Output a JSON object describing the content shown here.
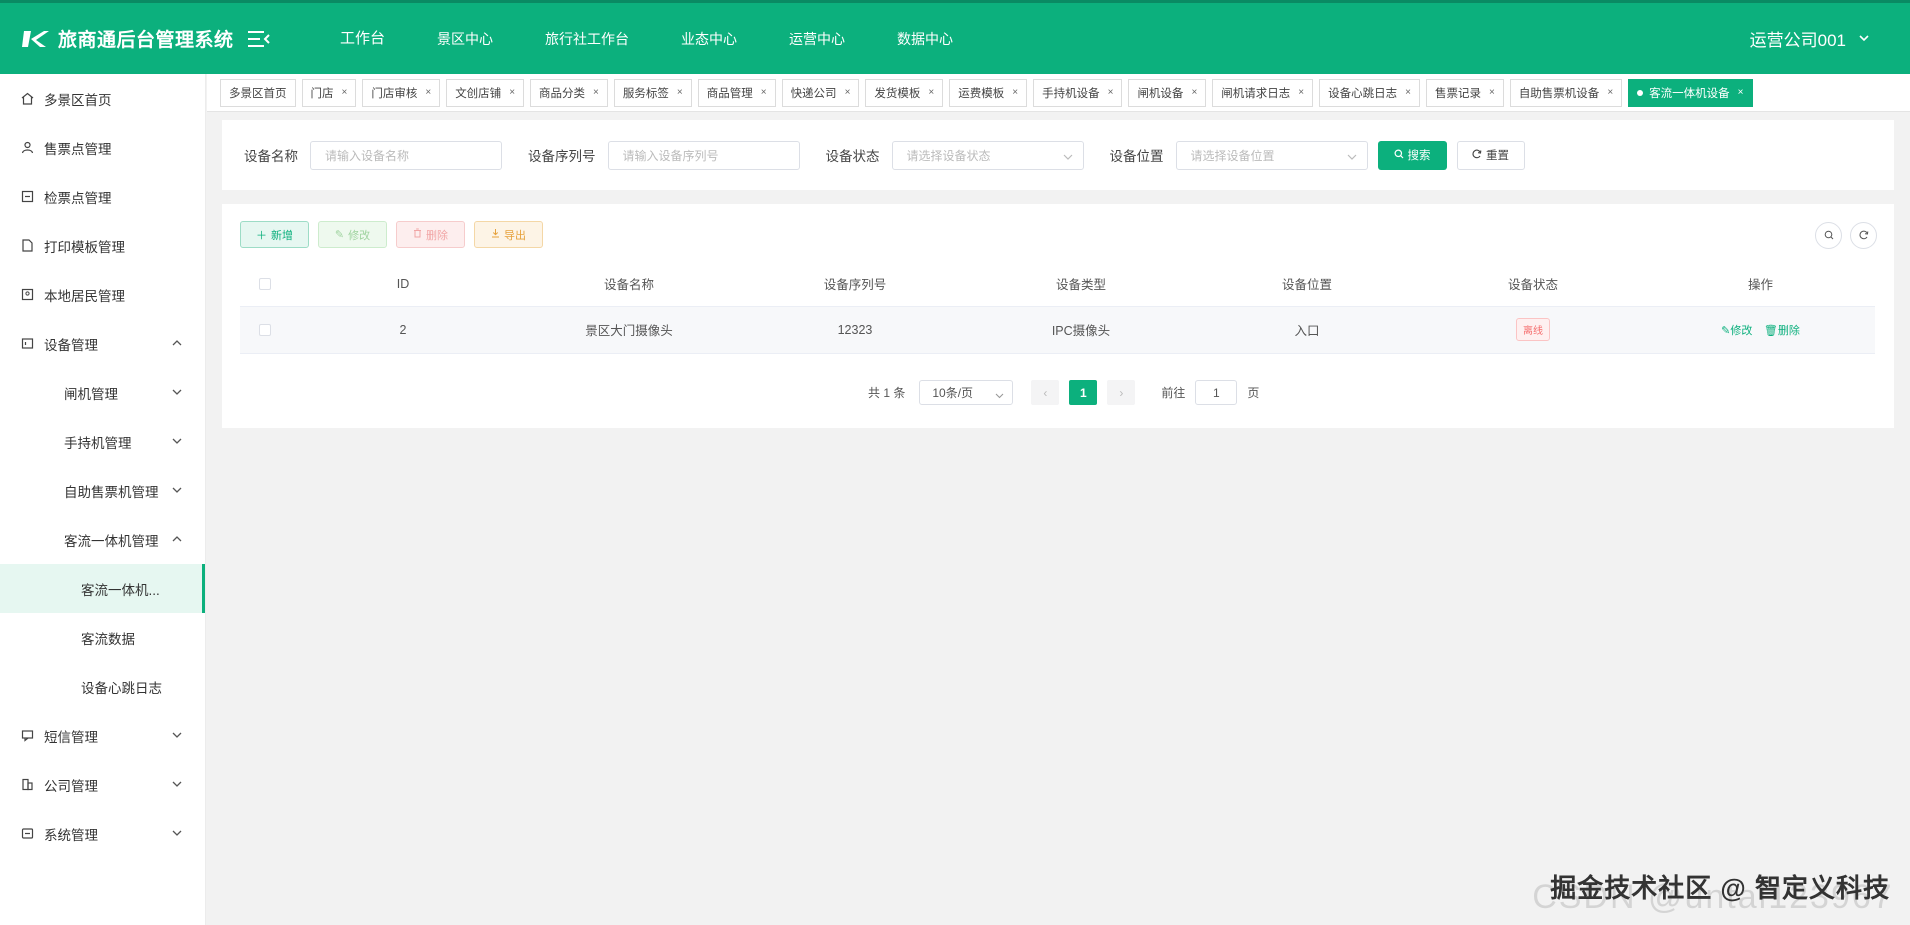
{
  "brand": {
    "title": "旅商通后台管理系统"
  },
  "topnav": [
    {
      "label": "工作台"
    },
    {
      "label": "景区中心"
    },
    {
      "label": "旅行社工作台"
    },
    {
      "label": "业态中心"
    },
    {
      "label": "运营中心"
    },
    {
      "label": "数据中心"
    }
  ],
  "company": {
    "name": "运营公司001"
  },
  "sidebar": {
    "items": [
      {
        "label": "多景区首页"
      },
      {
        "label": "售票点管理"
      },
      {
        "label": "检票点管理"
      },
      {
        "label": "打印模板管理"
      },
      {
        "label": "本地居民管理"
      },
      {
        "label": "设备管理"
      },
      {
        "label": "闸机管理"
      },
      {
        "label": "手持机管理"
      },
      {
        "label": "自助售票机管理"
      },
      {
        "label": "客流一体机管理"
      },
      {
        "label": "客流一体机..."
      },
      {
        "label": "客流数据"
      },
      {
        "label": "设备心跳日志"
      },
      {
        "label": "短信管理"
      },
      {
        "label": "公司管理"
      },
      {
        "label": "系统管理"
      }
    ]
  },
  "tags": [
    {
      "label": "多景区首页"
    },
    {
      "label": "门店"
    },
    {
      "label": "门店审核"
    },
    {
      "label": "文创店铺"
    },
    {
      "label": "商品分类"
    },
    {
      "label": "服务标签"
    },
    {
      "label": "商品管理"
    },
    {
      "label": "快递公司"
    },
    {
      "label": "发货模板"
    },
    {
      "label": "运费模板"
    },
    {
      "label": "手持机设备"
    },
    {
      "label": "闸机设备"
    },
    {
      "label": "闸机请求日志"
    },
    {
      "label": "设备心跳日志"
    },
    {
      "label": "售票记录"
    },
    {
      "label": "自助售票机设备"
    },
    {
      "label": "客流一体机设备"
    }
  ],
  "search": {
    "name_label": "设备名称",
    "name_placeholder": "请输入设备名称",
    "serial_label": "设备序列号",
    "serial_placeholder": "请输入设备序列号",
    "status_label": "设备状态",
    "status_placeholder": "请选择设备状态",
    "location_label": "设备位置",
    "location_placeholder": "请选择设备位置",
    "search_button": "搜索",
    "reset_button": "重置"
  },
  "toolbar": {
    "add": "新增",
    "edit": "修改",
    "delete": "删除",
    "export": "导出"
  },
  "table": {
    "columns": [
      "ID",
      "设备名称",
      "设备序列号",
      "设备类型",
      "设备位置",
      "设备状态",
      "操作"
    ],
    "rows": [
      {
        "id": "2",
        "name": "景区大门摄像头",
        "serial": "12323",
        "type": "IPC摄像头",
        "location": "入口",
        "status": "离线",
        "edit": "修改",
        "delete": "删除"
      }
    ]
  },
  "pagination": {
    "total": "共 1 条",
    "page_size": "10条/页",
    "current": "1",
    "goto_label": "前往",
    "goto_value": "1",
    "page_suffix": "页"
  },
  "watermark": {
    "text": "掘金技术社区 @ 智定义科技",
    "ghost": "CSDN @untal123967"
  },
  "colors": {
    "primary": "#0cb07d",
    "danger": "#f56c6c",
    "warning": "#e6a23c"
  }
}
